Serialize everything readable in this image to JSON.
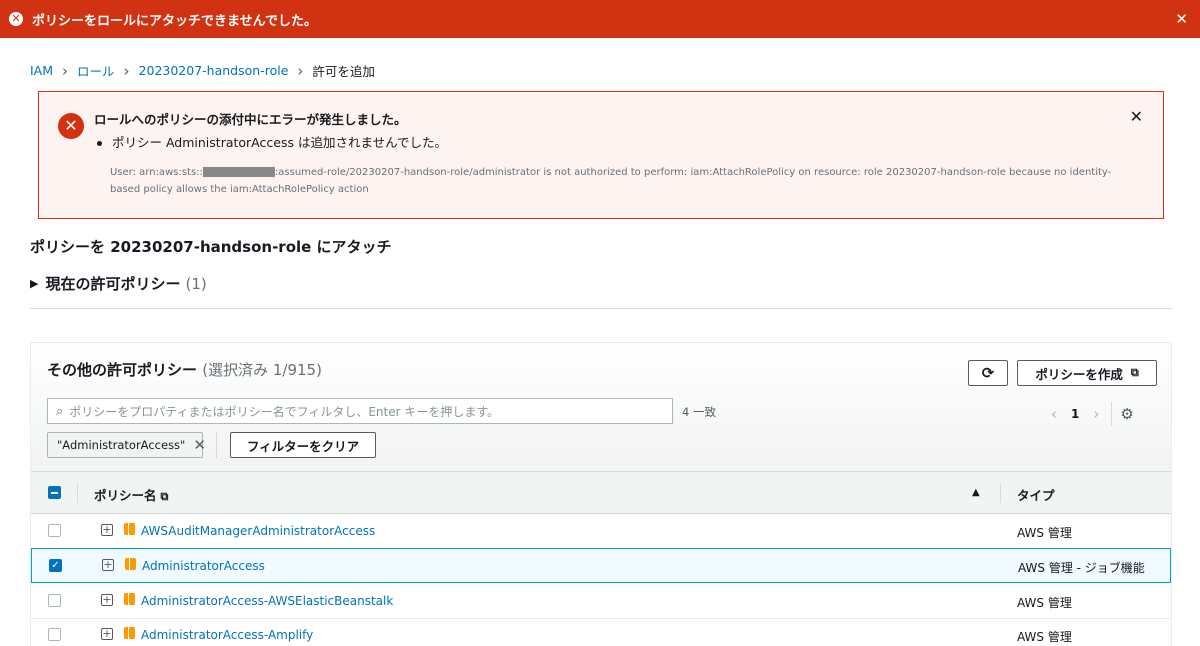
{
  "topbar": {
    "message": "ポリシーをロールにアタッチできませんでした。",
    "icon": "x-circle-icon"
  },
  "breadcrumb": {
    "items": [
      "IAM",
      "ロール",
      "20230207-handson-role"
    ],
    "current": "許可を追加"
  },
  "error": {
    "title": "ロールへのポリシーの添付中にエラーが発生しました。",
    "bullet": "ポリシー AdministratorAccess は追加されませんでした。",
    "detail_prefix": "User: arn:aws:sts::",
    "detail_suffix": ":assumed-role/20230207-handson-role/administrator is not authorized to perform: iam:AttachRolePolicy on resource: role 20230207-handson-role because no identity-based policy allows the iam:AttachRolePolicy action"
  },
  "page": {
    "heading": "ポリシーを 20230207-handson-role にアタッチ",
    "current_policies_label": "現在の許可ポリシー",
    "current_policies_count": "(1)"
  },
  "panel": {
    "title": "その他の許可ポリシー",
    "selected_text": "(選択済み 1/915)",
    "create_label": "ポリシーを作成",
    "search_placeholder": "ポリシーをプロパティまたはポリシー名でフィルタし、Enter キーを押します。",
    "match_count": "4 一致",
    "page_number": "1",
    "filter_token": "\"AdministratorAccess\"",
    "clear_label": "フィルターをクリア"
  },
  "table": {
    "col_name": "ポリシー名",
    "col_type": "タイプ",
    "rows": [
      {
        "name": "AWSAuditManagerAdministratorAccess",
        "type": "AWS 管理",
        "selected": false
      },
      {
        "name": "AdministratorAccess",
        "type": "AWS 管理 - ジョブ機能",
        "selected": true
      },
      {
        "name": "AdministratorAccess-AWSElasticBeanstalk",
        "type": "AWS 管理",
        "selected": false
      },
      {
        "name": "AdministratorAccess-Amplify",
        "type": "AWS 管理",
        "selected": false
      }
    ]
  },
  "colors": {
    "error_red": "#d13212",
    "link_blue": "#0073bb",
    "policy_orange": "#ff9900"
  }
}
